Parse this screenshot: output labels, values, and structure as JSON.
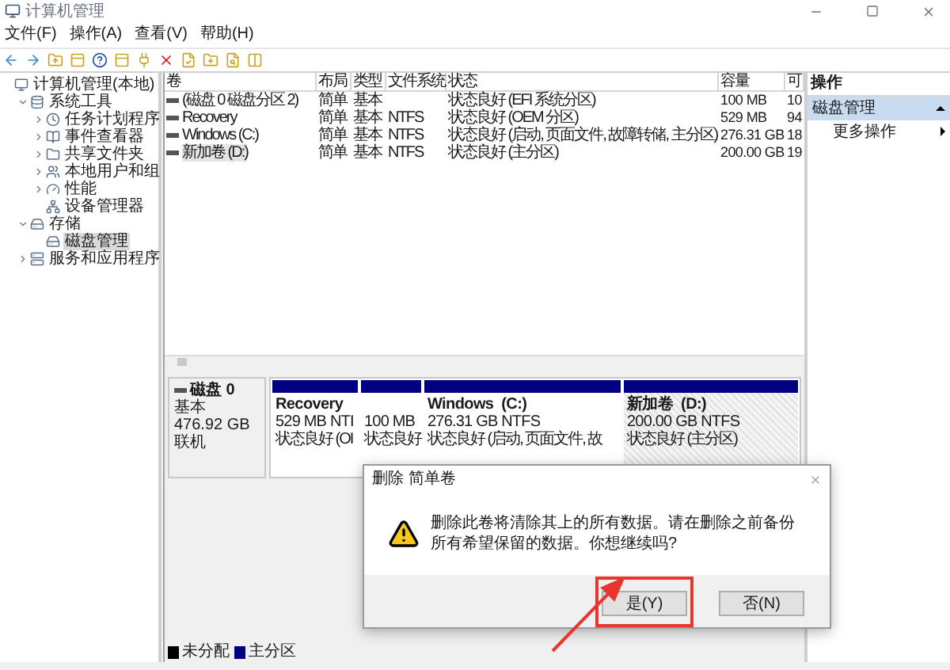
{
  "window": {
    "title": "计算机管理"
  },
  "menu": [
    "文件(F)",
    "操作(A)",
    "查看(V)",
    "帮助(H)"
  ],
  "tree": [
    {
      "label": "计算机管理(本地)",
      "selected": false,
      "children": [
        {
          "label": "系统工具",
          "expanded": true,
          "selected": false,
          "children": [
            {
              "label": "任务计划程序",
              "expanded": false,
              "selected": false
            },
            {
              "label": "事件查看器",
              "expanded": false,
              "selected": false
            },
            {
              "label": "共享文件夹",
              "expanded": false,
              "selected": false
            },
            {
              "label": "本地用户和组",
              "expanded": false,
              "selected": false
            },
            {
              "label": "性能",
              "expanded": false,
              "selected": false
            },
            {
              "label": "设备管理器",
              "selected": false
            }
          ]
        },
        {
          "label": "存储",
          "expanded": true,
          "selected": false,
          "children": [
            {
              "label": "磁盘管理",
              "selected": true
            }
          ]
        },
        {
          "label": "服务和应用程序",
          "expanded": false,
          "selected": false
        }
      ]
    }
  ],
  "table": {
    "columns": [
      "卷",
      "布局",
      "类型",
      "文件系统",
      "状态",
      "容量",
      "可"
    ],
    "rows": [
      {
        "selected": false,
        "cells": [
          "(磁盘 0 磁盘分区 2)",
          "简单",
          "基本",
          "",
          "状态良好 (EFI 系统分区)",
          "100 MB",
          "10"
        ]
      },
      {
        "selected": false,
        "cells": [
          "Recovery",
          "简单",
          "基本",
          "NTFS",
          "状态良好 (OEM 分区)",
          "529 MB",
          "94"
        ]
      },
      {
        "selected": false,
        "cells": [
          "Windows (C:)",
          "简单",
          "基本",
          "NTFS",
          "状态良好 (启动, 页面文件, 故障转储, 主分区)",
          "276.31 GB",
          "18"
        ]
      },
      {
        "selected": true,
        "cells": [
          "新加卷 (D:)",
          "简单",
          "基本",
          "NTFS",
          "状态良好 (主分区)",
          "200.00 GB",
          "19"
        ]
      }
    ]
  },
  "disk": {
    "name": "磁盘 0",
    "type": "基本",
    "size": "476.92 GB",
    "status": "联机",
    "partitions": [
      {
        "name": "Recovery",
        "size": "529 MB NTI",
        "status": "状态良好 (OI",
        "selected": false
      },
      {
        "size": "100 MB",
        "status": "状态良好",
        "selected": false
      },
      {
        "name": "Windows  (C:)",
        "size": "276.31 GB NTFS",
        "status": "状态良好 (启动, 页面文件, 故",
        "selected": false
      },
      {
        "name": "新加卷  (D:)",
        "size": "200.00 GB NTFS",
        "status": "状态良好 (主分区)",
        "selected": true
      }
    ]
  },
  "legend": [
    {
      "label": "未分配",
      "color": "#000000"
    },
    {
      "label": "主分区",
      "color": "#000080"
    }
  ],
  "actions": {
    "title": "操作",
    "section": "磁盘管理",
    "items": [
      "更多操作"
    ]
  },
  "dialog": {
    "title": "删除 简单卷",
    "message": "删除此卷将清除其上的所有数据。请在删除之前备份所有希望保留的数据。你想继续吗?",
    "buttons": [
      {
        "label": "是(Y)",
        "highlighted": true
      },
      {
        "label": "否(N)",
        "highlighted": false
      }
    ]
  }
}
